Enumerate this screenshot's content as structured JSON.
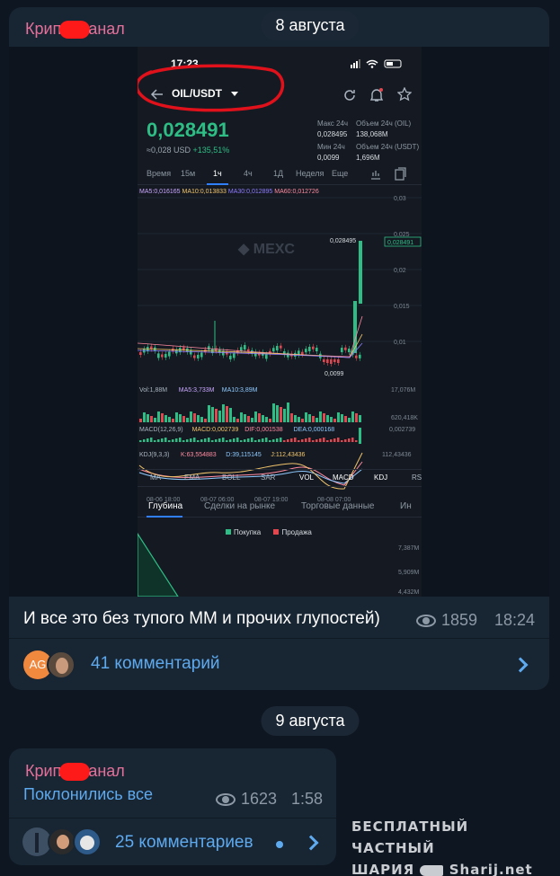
{
  "channel": {
    "name_prefix": "Крип",
    "name_suffix": "анал"
  },
  "post1": {
    "date": "8 августа",
    "screenshot": {
      "status_time": "17:23",
      "pair": "OIL/USDT",
      "price": "0,028491",
      "price_sub": "≈0,028 USD",
      "change": "+135,51%",
      "stats": [
        {
          "label": "Макс 24ч",
          "value": "0,028495"
        },
        {
          "label": "Объем 24ч (OIL)",
          "value": "138,068M"
        },
        {
          "label": "Мин 24ч",
          "value": "0,0099"
        },
        {
          "label": "Объем 24ч (USDT)",
          "value": "1,696M"
        }
      ],
      "timeframe_tabs": [
        "Время",
        "15м",
        "1ч",
        "4ч",
        "1Д",
        "Неделя",
        "Еще"
      ],
      "active_timeframe": "1ч",
      "ma_legend": [
        {
          "text": "MA5:0,016165",
          "color": "#c9a6ff"
        },
        {
          "text": "MA10:0,013833",
          "color": "#f0c36b"
        },
        {
          "text": "MA30:0,012895",
          "color": "#8e7bff"
        },
        {
          "text": "MA60:0,012726",
          "color": "#ff8aa0"
        }
      ],
      "watermark": "MEXC",
      "y_ticks": [
        "0,03",
        "0,025",
        "0,02",
        "0,015",
        "0,01"
      ],
      "price_marker": "0,028491",
      "high_label": "0,028495",
      "low_label": "0,0099",
      "vol_legend": [
        {
          "text": "Vol:1,88M",
          "color": "#aab3bf"
        },
        {
          "text": "MA5:3,733M",
          "color": "#c9a6ff"
        },
        {
          "text": "MA10:3,89M",
          "color": "#8ec9ff"
        }
      ],
      "vol_ticks": [
        "17,076M",
        "620,418K"
      ],
      "macd_legend": [
        {
          "text": "MACD(12,26,9)",
          "color": "#aab3bf"
        },
        {
          "text": "MACD:0,002739",
          "color": "#f0c36b"
        },
        {
          "text": "DIF:0,001538",
          "color": "#ff8aa0"
        },
        {
          "text": "DEA:0,000168",
          "color": "#8ec9ff"
        }
      ],
      "macd_tick": "0,002739",
      "kdj_legend": [
        {
          "text": "KDJ(9,3,3)",
          "color": "#aab3bf"
        },
        {
          "text": "K:63,554883",
          "color": "#ff8aa0"
        },
        {
          "text": "D:39,115145",
          "color": "#8ec9ff"
        },
        {
          "text": "J:112,43436",
          "color": "#f0c36b"
        }
      ],
      "kdj_tick": "112,43436",
      "x_ticks": [
        "08-06 18:00",
        "08-07 06:00",
        "08-07 19:00",
        "08-08 07:00"
      ],
      "indicators": [
        "MA",
        "EMA",
        "BOLL",
        "SAR",
        "VOL",
        "MACD",
        "KDJ",
        "RS"
      ],
      "active_indicators": [
        "VOL",
        "MACD",
        "KDJ"
      ],
      "depth_tabs": [
        "Глубина",
        "Сделки на рынке",
        "Торговые данные",
        "Ин"
      ],
      "depth_legend": [
        "Покупка",
        "Продажа"
      ],
      "depth_ticks": [
        "7,387M",
        "5,909M",
        "4,432M"
      ]
    },
    "caption": "И все это без тупого ММ и прочих глупостей)",
    "views": "1859",
    "time": "18:24",
    "avatar_initials": "AG",
    "comments": "41 комментарий"
  },
  "post2": {
    "date": "9 августа",
    "text": "Поклонились все",
    "views": "1623",
    "time": "1:58",
    "comments": "25 комментариев"
  },
  "watermark": {
    "line1": "БЕСПЛАТНЫЙ ЧАСТНЫЙ",
    "line2_a": "ШАРИЯ",
    "line2_b": "Sharij.net"
  },
  "colors": {
    "bg": "#0e1621",
    "bubble": "#182533",
    "accent": "#5eaaef",
    "channel": "#e5709a",
    "up": "#2ebd85",
    "down": "#e0474f",
    "annotation": "#e0111b"
  }
}
